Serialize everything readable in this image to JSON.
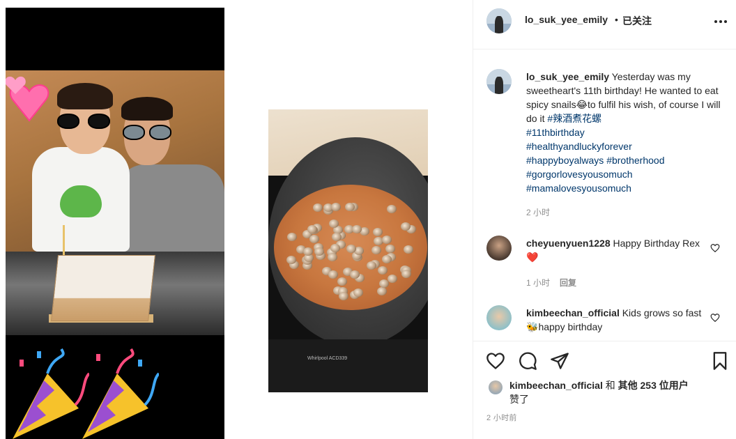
{
  "header": {
    "username": "lo_suk_yee_emily",
    "separator": "•",
    "follow_status": "已关注"
  },
  "caption": {
    "username": "lo_suk_yee_emily",
    "text_1": " Yesterday was my sweetheart's 11th birthday! He wanted to eat spicy snails",
    "emoji_1": "😂",
    "text_2": "to fulfil his wish, of course I will do it ",
    "hashtags": [
      "#辣酒煮花螺",
      "#11thbirthday",
      "#healthyandluckyforever",
      "#happyboyalways",
      "#brotherhood",
      "#gorgorlovesyousomuch",
      "#mamalovesyousomuch"
    ],
    "time": "2 小时"
  },
  "comments": [
    {
      "username": "cheyuenyuen1228",
      "text": " Happy Birthday Rex",
      "emoji": "❤️",
      "time": "1 小时",
      "reply": "回复"
    },
    {
      "username": "kimbeechan_official",
      "text": " Kids grows so fast",
      "emoji": "🐝",
      "text_after": "happy birthday"
    }
  ],
  "actions": {
    "icons": [
      "heart-icon",
      "comment-icon",
      "share-icon",
      "bookmark-icon"
    ],
    "likes_user": "kimbeechan_official",
    "likes_and": " 和 ",
    "likes_others": "其他 253 位用户",
    "likes_suffix": "赞了",
    "posted_time": "2 小时前"
  },
  "media": {
    "stove_brand": "Whirlpool  ACD339"
  },
  "colors": {
    "text": "#262626",
    "secondary": "#8e8e8e",
    "hashtag": "#00376b",
    "border": "#efefef"
  }
}
